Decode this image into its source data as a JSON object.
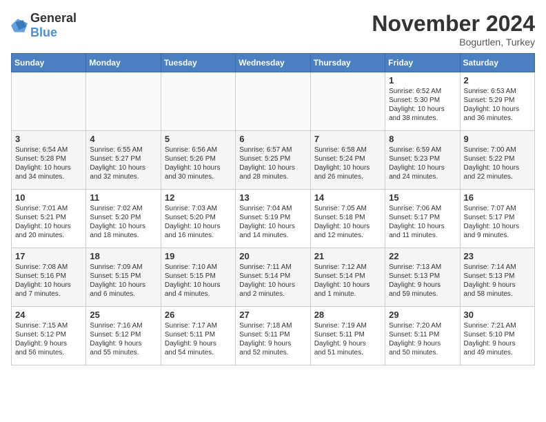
{
  "header": {
    "logo_general": "General",
    "logo_blue": "Blue",
    "month_title": "November 2024",
    "location": "Bogurtlen, Turkey"
  },
  "days_of_week": [
    "Sunday",
    "Monday",
    "Tuesday",
    "Wednesday",
    "Thursday",
    "Friday",
    "Saturday"
  ],
  "weeks": [
    [
      {
        "day": "",
        "info": ""
      },
      {
        "day": "",
        "info": ""
      },
      {
        "day": "",
        "info": ""
      },
      {
        "day": "",
        "info": ""
      },
      {
        "day": "",
        "info": ""
      },
      {
        "day": "1",
        "info": "Sunrise: 6:52 AM\nSunset: 5:30 PM\nDaylight: 10 hours\nand 38 minutes."
      },
      {
        "day": "2",
        "info": "Sunrise: 6:53 AM\nSunset: 5:29 PM\nDaylight: 10 hours\nand 36 minutes."
      }
    ],
    [
      {
        "day": "3",
        "info": "Sunrise: 6:54 AM\nSunset: 5:28 PM\nDaylight: 10 hours\nand 34 minutes."
      },
      {
        "day": "4",
        "info": "Sunrise: 6:55 AM\nSunset: 5:27 PM\nDaylight: 10 hours\nand 32 minutes."
      },
      {
        "day": "5",
        "info": "Sunrise: 6:56 AM\nSunset: 5:26 PM\nDaylight: 10 hours\nand 30 minutes."
      },
      {
        "day": "6",
        "info": "Sunrise: 6:57 AM\nSunset: 5:25 PM\nDaylight: 10 hours\nand 28 minutes."
      },
      {
        "day": "7",
        "info": "Sunrise: 6:58 AM\nSunset: 5:24 PM\nDaylight: 10 hours\nand 26 minutes."
      },
      {
        "day": "8",
        "info": "Sunrise: 6:59 AM\nSunset: 5:23 PM\nDaylight: 10 hours\nand 24 minutes."
      },
      {
        "day": "9",
        "info": "Sunrise: 7:00 AM\nSunset: 5:22 PM\nDaylight: 10 hours\nand 22 minutes."
      }
    ],
    [
      {
        "day": "10",
        "info": "Sunrise: 7:01 AM\nSunset: 5:21 PM\nDaylight: 10 hours\nand 20 minutes."
      },
      {
        "day": "11",
        "info": "Sunrise: 7:02 AM\nSunset: 5:20 PM\nDaylight: 10 hours\nand 18 minutes."
      },
      {
        "day": "12",
        "info": "Sunrise: 7:03 AM\nSunset: 5:20 PM\nDaylight: 10 hours\nand 16 minutes."
      },
      {
        "day": "13",
        "info": "Sunrise: 7:04 AM\nSunset: 5:19 PM\nDaylight: 10 hours\nand 14 minutes."
      },
      {
        "day": "14",
        "info": "Sunrise: 7:05 AM\nSunset: 5:18 PM\nDaylight: 10 hours\nand 12 minutes."
      },
      {
        "day": "15",
        "info": "Sunrise: 7:06 AM\nSunset: 5:17 PM\nDaylight: 10 hours\nand 11 minutes."
      },
      {
        "day": "16",
        "info": "Sunrise: 7:07 AM\nSunset: 5:17 PM\nDaylight: 10 hours\nand 9 minutes."
      }
    ],
    [
      {
        "day": "17",
        "info": "Sunrise: 7:08 AM\nSunset: 5:16 PM\nDaylight: 10 hours\nand 7 minutes."
      },
      {
        "day": "18",
        "info": "Sunrise: 7:09 AM\nSunset: 5:15 PM\nDaylight: 10 hours\nand 6 minutes."
      },
      {
        "day": "19",
        "info": "Sunrise: 7:10 AM\nSunset: 5:15 PM\nDaylight: 10 hours\nand 4 minutes."
      },
      {
        "day": "20",
        "info": "Sunrise: 7:11 AM\nSunset: 5:14 PM\nDaylight: 10 hours\nand 2 minutes."
      },
      {
        "day": "21",
        "info": "Sunrise: 7:12 AM\nSunset: 5:14 PM\nDaylight: 10 hours\nand 1 minute."
      },
      {
        "day": "22",
        "info": "Sunrise: 7:13 AM\nSunset: 5:13 PM\nDaylight: 9 hours\nand 59 minutes."
      },
      {
        "day": "23",
        "info": "Sunrise: 7:14 AM\nSunset: 5:13 PM\nDaylight: 9 hours\nand 58 minutes."
      }
    ],
    [
      {
        "day": "24",
        "info": "Sunrise: 7:15 AM\nSunset: 5:12 PM\nDaylight: 9 hours\nand 56 minutes."
      },
      {
        "day": "25",
        "info": "Sunrise: 7:16 AM\nSunset: 5:12 PM\nDaylight: 9 hours\nand 55 minutes."
      },
      {
        "day": "26",
        "info": "Sunrise: 7:17 AM\nSunset: 5:11 PM\nDaylight: 9 hours\nand 54 minutes."
      },
      {
        "day": "27",
        "info": "Sunrise: 7:18 AM\nSunset: 5:11 PM\nDaylight: 9 hours\nand 52 minutes."
      },
      {
        "day": "28",
        "info": "Sunrise: 7:19 AM\nSunset: 5:11 PM\nDaylight: 9 hours\nand 51 minutes."
      },
      {
        "day": "29",
        "info": "Sunrise: 7:20 AM\nSunset: 5:11 PM\nDaylight: 9 hours\nand 50 minutes."
      },
      {
        "day": "30",
        "info": "Sunrise: 7:21 AM\nSunset: 5:10 PM\nDaylight: 9 hours\nand 49 minutes."
      }
    ]
  ]
}
